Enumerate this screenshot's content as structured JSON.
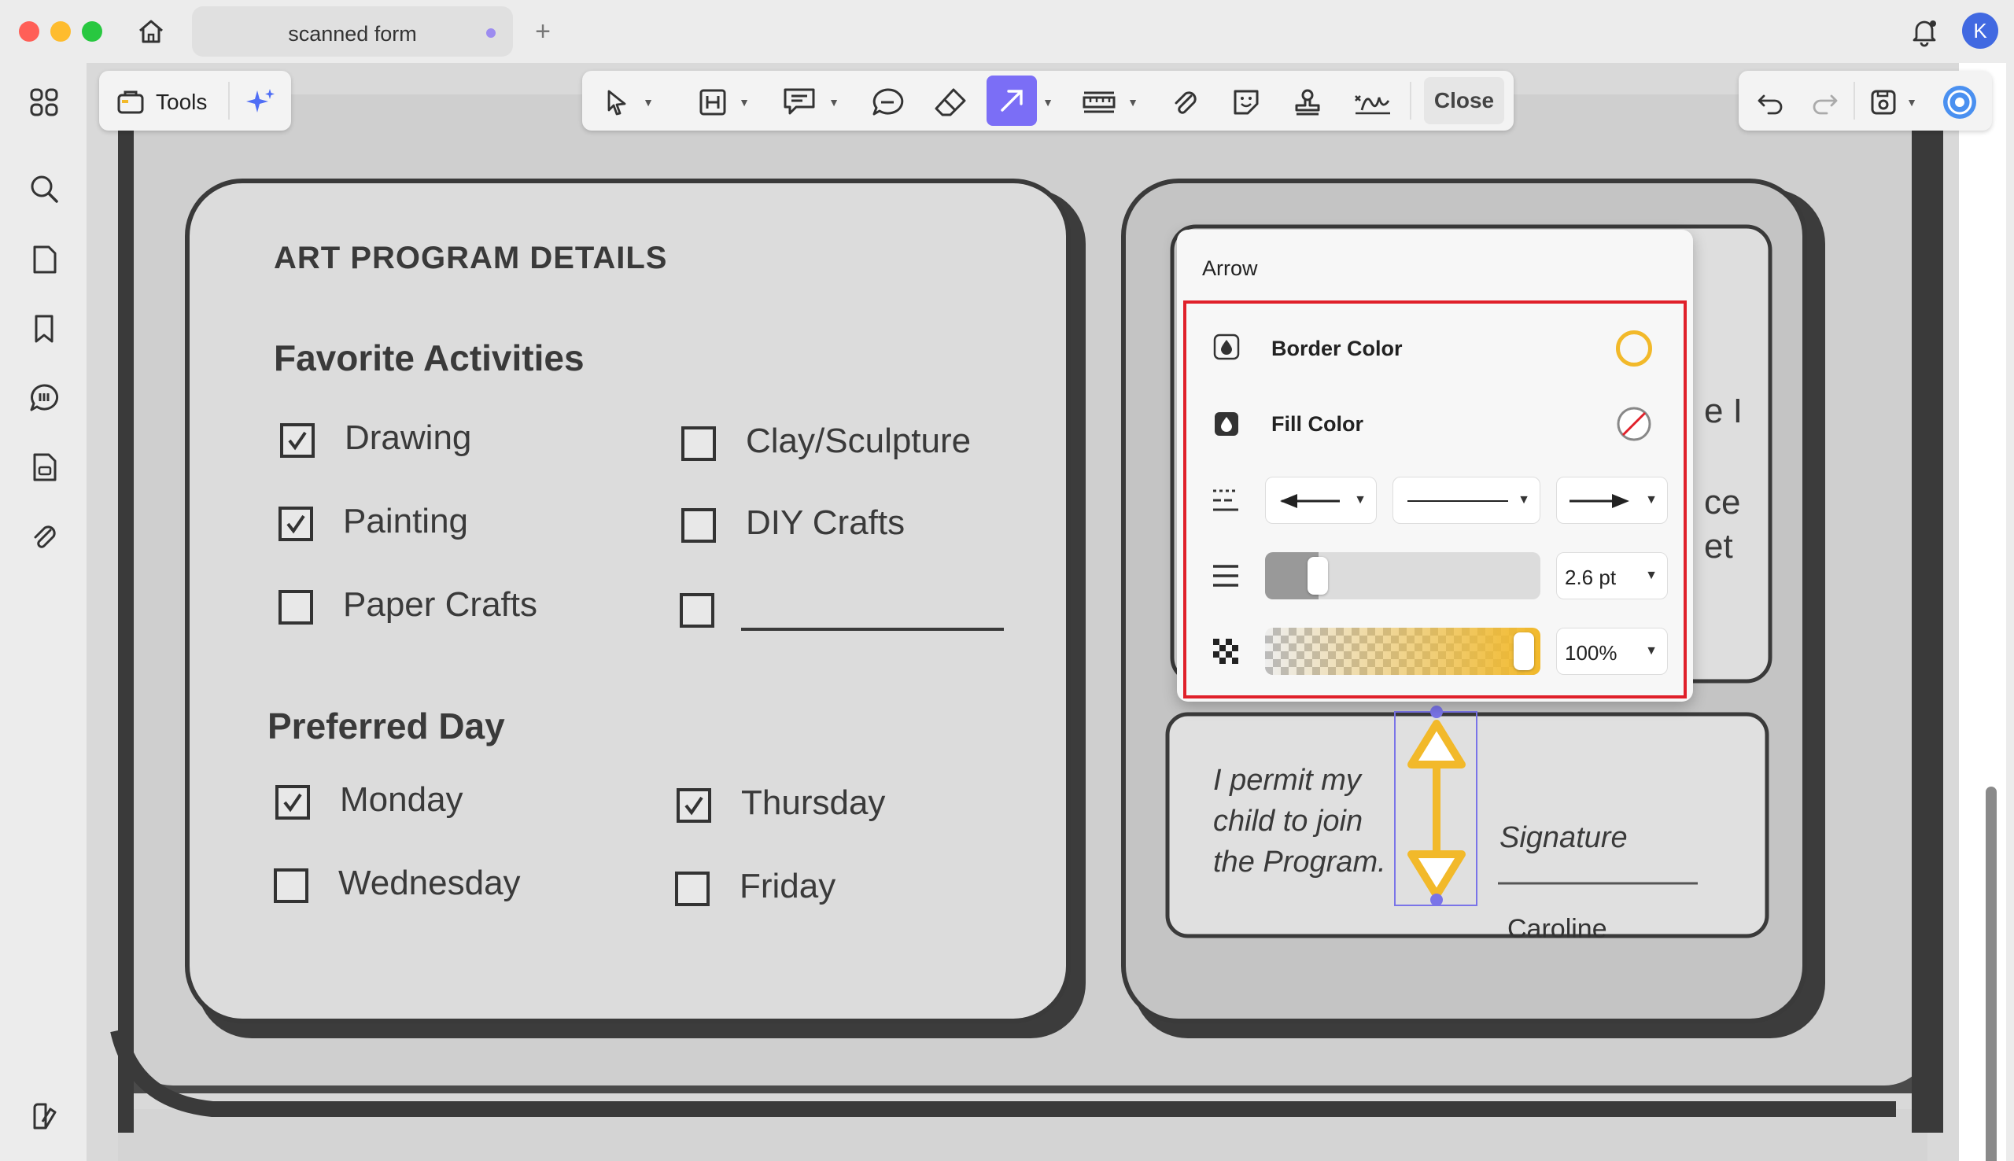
{
  "tab": {
    "title": "scanned form"
  },
  "user": {
    "initial": "K"
  },
  "toolbar": {
    "tools_label": "Tools",
    "close_label": "Close"
  },
  "form": {
    "section_title": "ART PROGRAM DETAILS",
    "activities_heading": "Favorite Activities",
    "activities": [
      {
        "label": "Drawing",
        "checked": true
      },
      {
        "label": "Clay/Sculpture",
        "checked": false
      },
      {
        "label": "Painting",
        "checked": true
      },
      {
        "label": "DIY Crafts",
        "checked": false
      },
      {
        "label": "Paper Crafts",
        "checked": false
      },
      {
        "label": "",
        "checked": false
      }
    ],
    "day_heading": "Preferred Day",
    "days": [
      {
        "label": "Monday",
        "checked": true
      },
      {
        "label": "Thursday",
        "checked": true
      },
      {
        "label": "Wednesday",
        "checked": false
      },
      {
        "label": "Friday",
        "checked": false
      }
    ],
    "partial_text": [
      "e I",
      "ce",
      "et"
    ],
    "permit_lines": [
      "I permit my",
      "child to join",
      "the Program."
    ],
    "signature_label": "Signature",
    "signature_value": "Caroline"
  },
  "popup": {
    "title": "Arrow",
    "border_color_label": "Border Color",
    "fill_color_label": "Fill Color",
    "border_color": "#f2b92a",
    "thickness": "2.6 pt",
    "opacity": "100%",
    "thickness_level": 0.1,
    "opacity_level": 1.0
  },
  "colors": {
    "accent": "#7b6ef6",
    "annotation": "#f2b92a",
    "highlight": "#e0202a"
  }
}
